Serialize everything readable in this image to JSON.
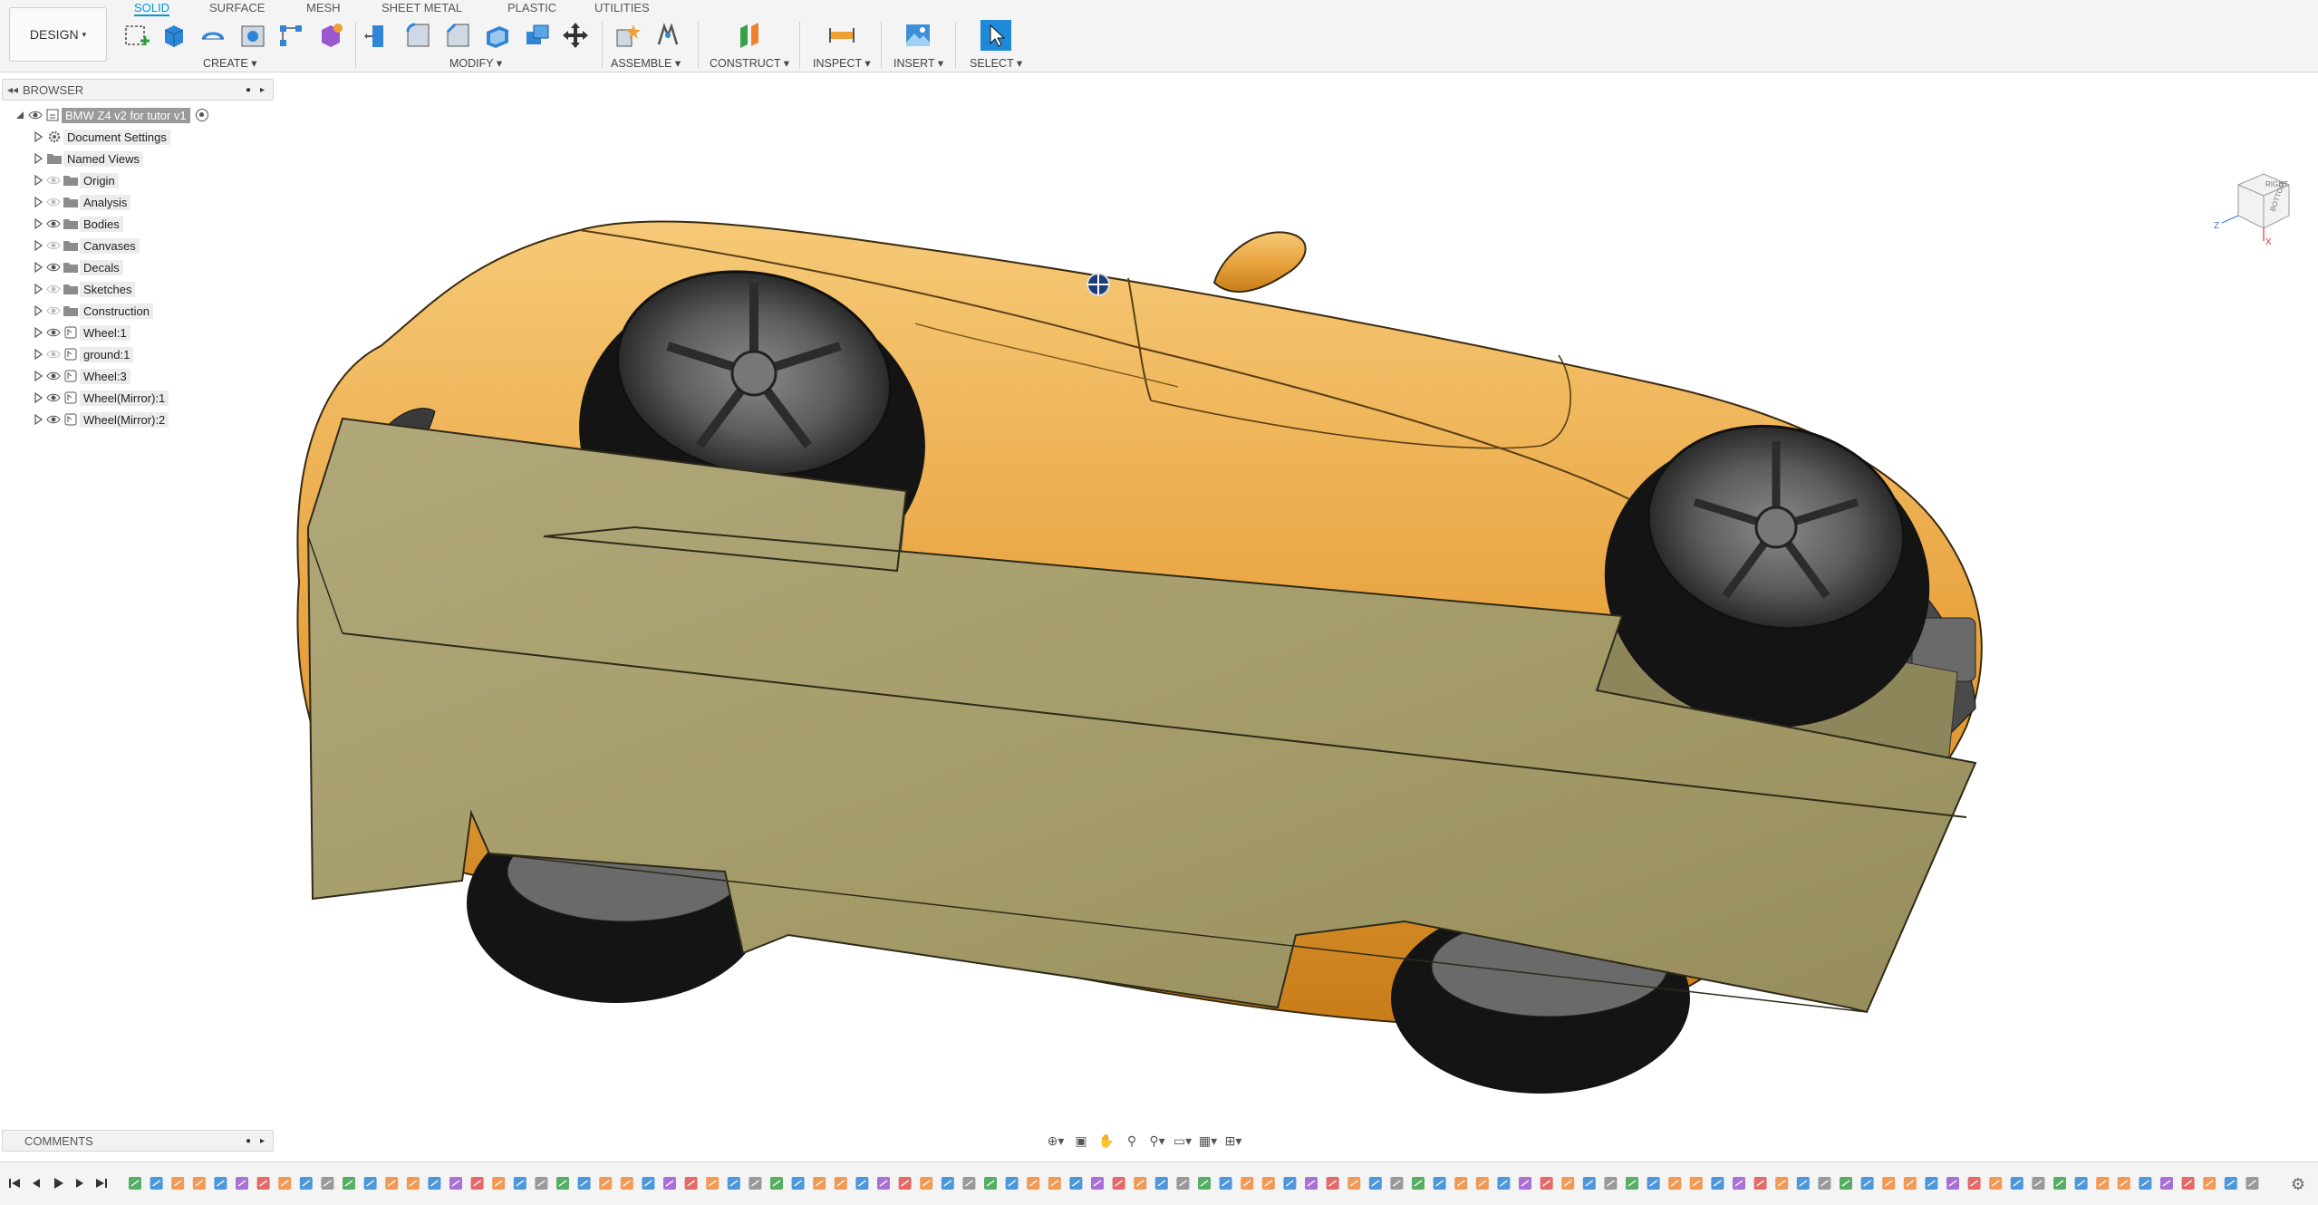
{
  "workspace": {
    "label": "DESIGN"
  },
  "tabs": [
    {
      "label": "SOLID",
      "active": true
    },
    {
      "label": "SURFACE",
      "active": false
    },
    {
      "label": "MESH",
      "active": false
    },
    {
      "label": "SHEET METAL",
      "active": false
    },
    {
      "label": "PLASTIC",
      "active": false
    },
    {
      "label": "UTILITIES",
      "active": false
    }
  ],
  "groups": {
    "create": "CREATE",
    "modify": "MODIFY",
    "assemble": "ASSEMBLE",
    "construct": "CONSTRUCT",
    "inspect": "INSPECT",
    "insert": "INSERT",
    "select": "SELECT"
  },
  "browser": {
    "title": "BROWSER",
    "root": "BMW Z4 v2 for tutor v1",
    "items": [
      {
        "label": "Document Settings",
        "icon": "gear-icon",
        "eye": false
      },
      {
        "label": "Named Views",
        "icon": "folder-icon",
        "eye": false
      },
      {
        "label": "Origin",
        "icon": "folder-icon",
        "eye": true,
        "eye_state": "hidden"
      },
      {
        "label": "Analysis",
        "icon": "folder-icon",
        "eye": true,
        "eye_state": "hidden"
      },
      {
        "label": "Bodies",
        "icon": "folder-icon",
        "eye": true,
        "eye_state": "visible"
      },
      {
        "label": "Canvases",
        "icon": "folder-icon",
        "eye": true,
        "eye_state": "hidden"
      },
      {
        "label": "Decals",
        "icon": "folder-icon",
        "eye": true,
        "eye_state": "visible"
      },
      {
        "label": "Sketches",
        "icon": "folder-icon",
        "eye": true,
        "eye_state": "hidden"
      },
      {
        "label": "Construction",
        "icon": "folder-icon",
        "eye": true,
        "eye_state": "hidden"
      },
      {
        "label": "Wheel:1",
        "icon": "component-icon",
        "eye": true,
        "eye_state": "visible"
      },
      {
        "label": "ground:1",
        "icon": "component-icon",
        "eye": true,
        "eye_state": "hidden"
      },
      {
        "label": "Wheel:3",
        "icon": "component-icon",
        "eye": true,
        "eye_state": "visible"
      },
      {
        "label": "Wheel(Mirror):1",
        "icon": "component-icon",
        "eye": true,
        "eye_state": "visible"
      },
      {
        "label": "Wheel(Mirror):2",
        "icon": "component-icon",
        "eye": true,
        "eye_state": "visible"
      }
    ]
  },
  "viewcube": {
    "face_top": "RIGHT",
    "face_front": "BOTTOM",
    "axis_z": "Z",
    "axis_x": "X"
  },
  "comments": {
    "title": "COMMENTS"
  },
  "colors": {
    "accent": "#0696d7",
    "car_paint": "#e8a23a",
    "ground_box": "#a59c6a",
    "tire": "#141414"
  }
}
